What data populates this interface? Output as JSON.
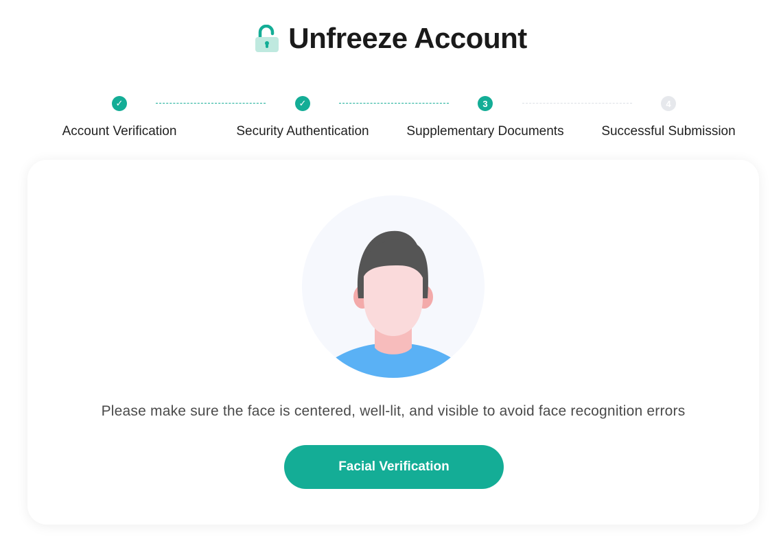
{
  "header": {
    "title": "Unfreeze Account",
    "icon": "unlock-icon",
    "accent_color": "#14ad96"
  },
  "stepper": {
    "steps": [
      {
        "label": "Account Verification",
        "status": "done",
        "marker": "✓"
      },
      {
        "label": "Security Authentication",
        "status": "done",
        "marker": "✓"
      },
      {
        "label": "Supplementary Documents",
        "status": "active",
        "marker": "3"
      },
      {
        "label": "Successful Submission",
        "status": "pending",
        "marker": "4"
      }
    ]
  },
  "main": {
    "illustration": "face-avatar-icon",
    "hint": "Please make sure the face is centered, well-lit, and visible to avoid face recognition errors",
    "button_label": "Facial Verification"
  }
}
